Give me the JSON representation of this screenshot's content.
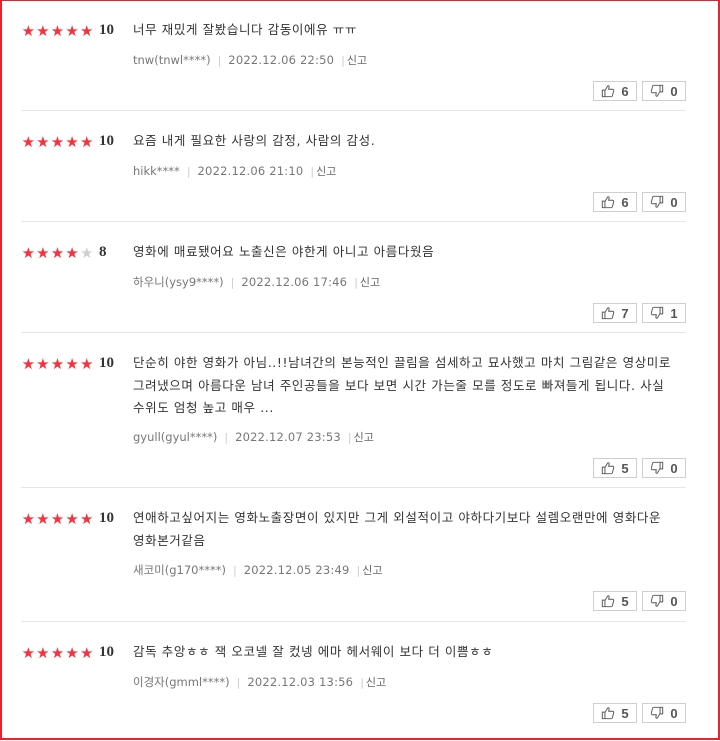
{
  "accent_color": "#f5333f",
  "reviews": [
    {
      "stars": 5,
      "score": "10",
      "text": "너무 재밌게 잘봤습니다 감동이에유 ㅠㅠ",
      "author": "tnw(tnwl****)",
      "date": "2022.12.06 22:50",
      "report": "신고",
      "up": "6",
      "down": "0"
    },
    {
      "stars": 5,
      "score": "10",
      "text": "요즘 내게 필요한 사랑의 감정, 사람의 감성.",
      "author": "hikk****",
      "date": "2022.12.06 21:10",
      "report": "신고",
      "up": "6",
      "down": "0"
    },
    {
      "stars": 4,
      "score": "8",
      "text": "영화에 매료됐어요 노출신은 야한게 아니고 아름다웠음",
      "author": "하우니(ysy9****)",
      "date": "2022.12.06 17:46",
      "report": "신고",
      "up": "7",
      "down": "1"
    },
    {
      "stars": 5,
      "score": "10",
      "text": "단순히 야한 영화가 아님..!!남녀간의 본능적인 끌림을 섬세하고 묘사했고 마치 그림같은 영상미로 그려냈으며 아름다운 남녀 주인공들을 보다 보면 시간 가는줄 모를 정도로 빠져들게 됩니다. 사실 수위도 엄청 높고 매우 ...",
      "author": "gyull(gyul****)",
      "date": "2022.12.07 23:53",
      "report": "신고",
      "up": "5",
      "down": "0"
    },
    {
      "stars": 5,
      "score": "10",
      "text": "연애하고싶어지는 영화노출장면이 있지만 그게 외설적이고 야하다기보다 설렘오랜만에 영화다운 영화본거같음",
      "author": "새코미(g170****)",
      "date": "2022.12.05 23:49",
      "report": "신고",
      "up": "5",
      "down": "0"
    },
    {
      "stars": 5,
      "score": "10",
      "text": "감독 추앙ㅎㅎ 잭 오코넬 잘 컸넹 에마 헤서웨이 보다 더 이쁨ㅎㅎ",
      "author": "이경자(gmml****)",
      "date": "2022.12.03 13:56",
      "report": "신고",
      "up": "5",
      "down": "0"
    }
  ]
}
